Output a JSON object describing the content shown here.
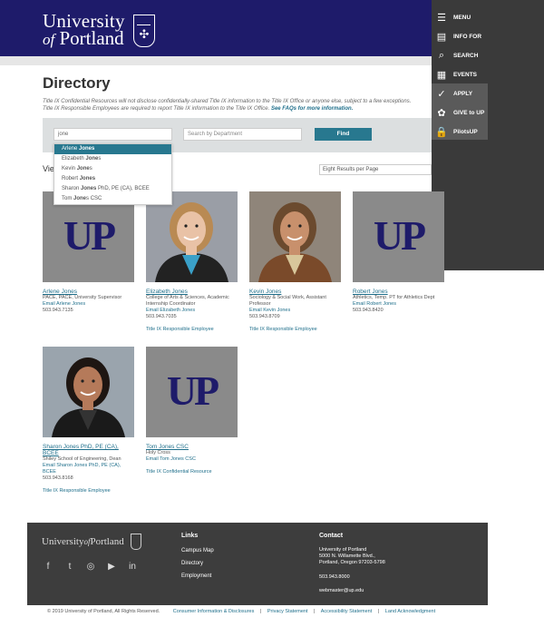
{
  "header": {
    "logo_line1": "University",
    "logo_line2a": "of",
    "logo_line2b": "Portland"
  },
  "side_menu": [
    {
      "label": "MENU",
      "icon": "menu-icon"
    },
    {
      "label": "INFO FOR",
      "icon": "document-icon"
    },
    {
      "label": "SEARCH",
      "icon": "search-icon"
    },
    {
      "label": "EVENTS",
      "icon": "calendar-icon"
    },
    {
      "label": "APPLY",
      "icon": "check-circle-icon"
    },
    {
      "label": "GIVE to UP",
      "icon": "gift-icon"
    },
    {
      "label": "PilotsUP",
      "icon": "lock-icon"
    }
  ],
  "page": {
    "title": "Directory",
    "notice_line1": "Title IX Confidential Resources will not disclose confidentially-shared Title IX information to the Title IX Office or anyone else, subject to a few exceptions.",
    "notice_line2": "Title IX Responsible Employees are required to report Title IX information to the Title IX Office.",
    "notice_link": "See FAQs for more information."
  },
  "search": {
    "name_value": "jone",
    "department_placeholder": "Search by Department",
    "find_label": "Find",
    "view_label": "Vie",
    "per_page": "Eight Results per Page"
  },
  "autocomplete": [
    {
      "pre": "Arlene ",
      "match": "Jones",
      "post": ""
    },
    {
      "pre": "Elizabeth ",
      "match": "Jone",
      "post": "s"
    },
    {
      "pre": "Kevin ",
      "match": "Jone",
      "post": "s"
    },
    {
      "pre": "Robert ",
      "match": "Jones",
      "post": ""
    },
    {
      "pre": "Sharon ",
      "match": "Jones",
      "post": " PhD, PE (CA), BCEE"
    },
    {
      "pre": "Tom ",
      "match": "Jone",
      "post": "s CSC"
    }
  ],
  "people": [
    {
      "name": "Arlene Jones",
      "role": [
        "PACE, PACE, University Supervisor"
      ],
      "email": "Email Arlene Jones",
      "phone": "503.943.7135",
      "tag": "",
      "photo": "up-logo"
    },
    {
      "name": "Elizabeth Jones",
      "role": [
        "College of Arts & Sciences, Academic",
        "Internship Coordinator"
      ],
      "email": "Email Elizabeth Jones",
      "phone": "503.943.7035",
      "tag": "Title IX Responsible Employee",
      "photo": "headshot"
    },
    {
      "name": "Kevin Jones",
      "role": [
        "Sociology & Social Work, Assistant",
        "Professor"
      ],
      "email": "Email Kevin Jones",
      "phone": "503.943.8709",
      "tag": "Title IX Responsible Employee",
      "photo": "headshot"
    },
    {
      "name": "Robert Jones",
      "role": [
        "Athletics, Temp. PT for Athletics Dept"
      ],
      "email": "Email Robert Jones",
      "phone": "503.943.8420",
      "tag": "",
      "photo": "up-logo"
    },
    {
      "name": "Sharon Jones PhD, PE (CA), BCEE",
      "role": [
        "Shiley School of Engineering, Dean"
      ],
      "email": "Email Sharon Jones PhD, PE (CA), BCEE",
      "phone": "503.943.8168",
      "tag": "Title IX Responsible Employee",
      "photo": "headshot"
    },
    {
      "name": "Tom Jones CSC",
      "role": [
        "Holy Cross"
      ],
      "email": "Email Tom Jones CSC",
      "phone": "",
      "tag": "Title IX Confidential Resource",
      "photo": "up-logo"
    }
  ],
  "up_logo_text": "UP",
  "footer": {
    "logo_a": "University",
    "logo_b": "of",
    "logo_c": "Portland",
    "social": [
      "facebook-icon",
      "twitter-icon",
      "instagram-icon",
      "youtube-icon",
      "linkedin-icon"
    ],
    "social_glyphs": [
      "f",
      "t",
      "◎",
      "▶",
      "in"
    ],
    "links_heading": "Links",
    "links": [
      "Campus Map",
      "Directory",
      "Employment"
    ],
    "contact_heading": "Contact",
    "address": [
      "University of Portland",
      "5000 N. Willamette Blvd.,",
      "Portland, Oregon 97203-5798"
    ],
    "phone": "503.943.8000",
    "email": "webmaster@up.edu"
  },
  "bottom": {
    "copyright": "© 2019 University of Portland, All Rights Reserved.",
    "links": [
      "Consumer Information & Disclosures",
      "Privacy Statement",
      "Accessibility Statement",
      "Land Acknowledgment"
    ]
  },
  "colors": {
    "navy": "#1e1b6a",
    "teal": "#28788f",
    "side_menu": "#3a3a3a",
    "footer": "#3d3d3d"
  }
}
